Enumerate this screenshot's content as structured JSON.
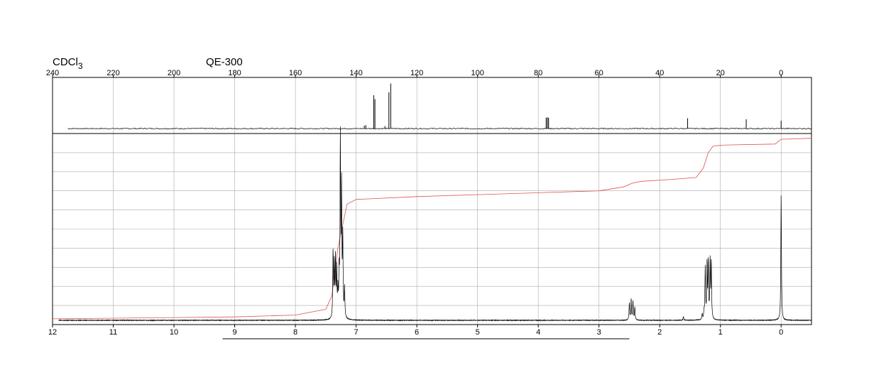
{
  "header": {
    "solvent_base": "CDCl",
    "solvent_sub": "3",
    "instrument": "QE-300"
  },
  "colors": {
    "spectrum": "#000000",
    "integral": "#e05050",
    "grid": "#aaaaaa"
  },
  "chart_data": [
    {
      "type": "line",
      "name": "13C NMR",
      "xlim": [
        240,
        -10
      ],
      "x_ticks": [
        240,
        220,
        200,
        180,
        160,
        140,
        120,
        100,
        80,
        60,
        40,
        20,
        0
      ],
      "tick_labels": [
        "240",
        "220",
        "200",
        "180",
        "160",
        "140",
        "120",
        "100",
        "80",
        "60",
        "40",
        "20",
        "0"
      ],
      "grid": true,
      "peaks": [
        {
          "x": 137.3,
          "h": 0.06
        },
        {
          "x": 136.8,
          "h": 0.07
        },
        {
          "x": 134.2,
          "h": 0.68
        },
        {
          "x": 133.8,
          "h": 0.6
        },
        {
          "x": 130.5,
          "h": 0.05
        },
        {
          "x": 129.2,
          "h": 0.74
        },
        {
          "x": 128.6,
          "h": 0.92
        },
        {
          "x": 77.4,
          "h": 0.22
        },
        {
          "x": 77.0,
          "h": 0.23
        },
        {
          "x": 76.6,
          "h": 0.22
        },
        {
          "x": 30.8,
          "h": 0.21
        },
        {
          "x": 11.5,
          "h": 0.19
        },
        {
          "x": 0.0,
          "h": 0.16
        }
      ]
    },
    {
      "type": "line",
      "name": "1H NMR",
      "xlim": [
        12,
        -0.5
      ],
      "x_ticks": [
        12,
        11,
        10,
        9,
        8,
        7,
        6,
        5,
        4,
        3,
        2,
        1,
        0
      ],
      "tick_labels": [
        "12",
        "11",
        "10",
        "9",
        "8",
        "7",
        "6",
        "5",
        "4",
        "3",
        "2",
        "1",
        "0"
      ],
      "grid": true,
      "horizontal_gridlines": 10,
      "peaks": [
        {
          "x": 7.38,
          "h": 0.35
        },
        {
          "x": 7.36,
          "h": 0.28
        },
        {
          "x": 7.34,
          "h": 0.31
        },
        {
          "x": 7.32,
          "h": 0.25
        },
        {
          "x": 7.3,
          "h": 0.14
        },
        {
          "x": 7.28,
          "h": 0.22
        },
        {
          "x": 7.26,
          "h": 0.96
        },
        {
          "x": 7.24,
          "h": 0.68
        },
        {
          "x": 7.22,
          "h": 0.42
        },
        {
          "x": 7.19,
          "h": 0.16
        },
        {
          "x": 2.5,
          "h": 0.09
        },
        {
          "x": 2.47,
          "h": 0.11
        },
        {
          "x": 2.44,
          "h": 0.1
        },
        {
          "x": 2.41,
          "h": 0.07
        },
        {
          "x": 1.61,
          "h": 0.02
        },
        {
          "x": 1.3,
          "h": 0.03
        },
        {
          "x": 1.27,
          "h": 0.04
        },
        {
          "x": 1.25,
          "h": 0.28
        },
        {
          "x": 1.22,
          "h": 0.29
        },
        {
          "x": 1.2,
          "h": 0.3
        },
        {
          "x": 1.17,
          "h": 0.31
        },
        {
          "x": 1.15,
          "h": 0.3
        },
        {
          "x": 0.0,
          "h": 0.68
        }
      ],
      "integral": [
        [
          12,
          0.03
        ],
        [
          9,
          0.04
        ],
        [
          8,
          0.05
        ],
        [
          7.5,
          0.08
        ],
        [
          7.4,
          0.15
        ],
        [
          7.3,
          0.4
        ],
        [
          7.15,
          0.63
        ],
        [
          7.0,
          0.655
        ],
        [
          6.0,
          0.67
        ],
        [
          5.0,
          0.68
        ],
        [
          4.0,
          0.69
        ],
        [
          3.0,
          0.7
        ],
        [
          2.6,
          0.72
        ],
        [
          2.45,
          0.74
        ],
        [
          2.3,
          0.75
        ],
        [
          1.8,
          0.76
        ],
        [
          1.4,
          0.77
        ],
        [
          1.28,
          0.82
        ],
        [
          1.2,
          0.9
        ],
        [
          1.12,
          0.935
        ],
        [
          0.9,
          0.94
        ],
        [
          0.1,
          0.945
        ],
        [
          0.0,
          0.97
        ],
        [
          -0.5,
          0.975
        ]
      ],
      "ppm_bar": [
        9.2,
        2.5
      ]
    }
  ]
}
